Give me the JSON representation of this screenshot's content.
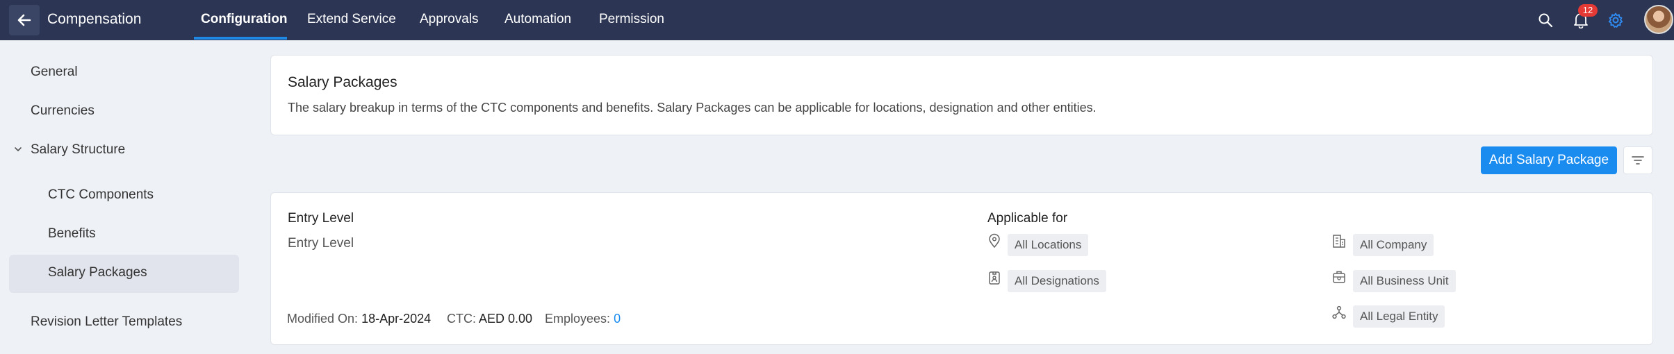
{
  "header": {
    "app_title": "Compensation",
    "tabs": [
      {
        "label": "Configuration",
        "active": true
      },
      {
        "label": "Extend Service"
      },
      {
        "label": "Approvals"
      },
      {
        "label": "Automation"
      },
      {
        "label": "Permission"
      }
    ],
    "notification_count": "12",
    "icons": [
      "back-arrow-icon",
      "search-icon",
      "bell-icon",
      "gear-icon"
    ],
    "accent_color": "#1e88e5",
    "bar_color": "#2c3654"
  },
  "sidebar": {
    "items": [
      {
        "label": "General"
      },
      {
        "label": "Currencies"
      },
      {
        "label": "Salary Structure",
        "expanded": true
      },
      {
        "label": "CTC Components"
      },
      {
        "label": "Benefits"
      },
      {
        "label": "Salary Packages",
        "active": true
      },
      {
        "label": "Revision Letter Templates"
      }
    ]
  },
  "intro": {
    "title": "Salary Packages",
    "description": "The salary breakup in terms of the CTC components and benefits. Salary Packages can be applicable for locations, designation and other entities."
  },
  "toolbar": {
    "add_label": "Add Salary Package",
    "button_color": "#1a8cf0"
  },
  "package": {
    "title": "Entry Level",
    "subtitle": "Entry Level",
    "applicable_label": "Applicable for",
    "chips": {
      "locations": "All Locations",
      "designations": "All Designations",
      "company": "All Company",
      "business_unit": "All Business Unit",
      "legal_entity": "All Legal Entity"
    },
    "modified_label": "Modified On:",
    "modified_value": "18-Apr-2024",
    "ctc_label": "CTC:",
    "ctc_value": "AED 0.00",
    "employees_label": "Employees:",
    "employees_value": "0"
  }
}
